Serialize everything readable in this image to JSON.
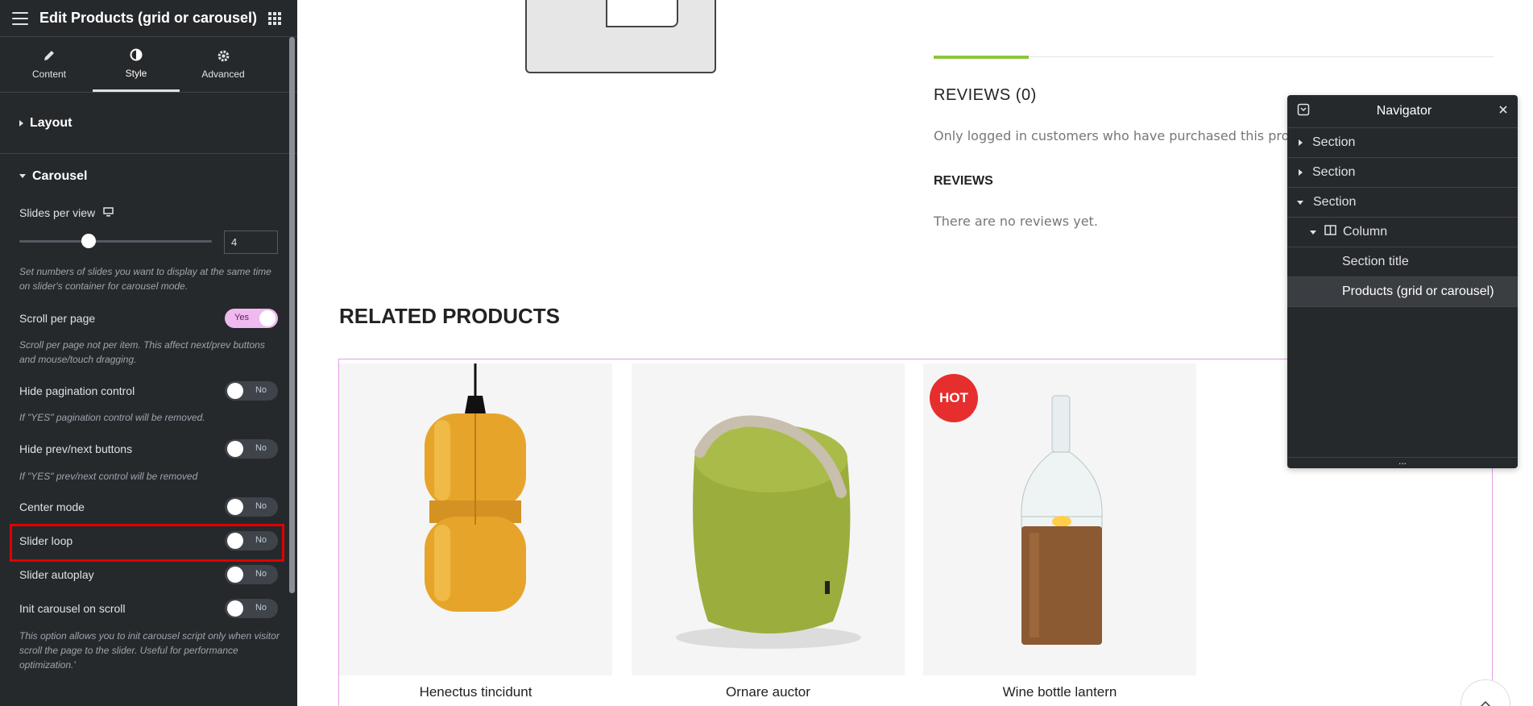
{
  "panel": {
    "title": "Edit Products (grid or carousel)",
    "tabs": [
      {
        "label": "Content",
        "icon": "pencil-icon"
      },
      {
        "label": "Style",
        "icon": "contrast-icon"
      },
      {
        "label": "Advanced",
        "icon": "gear-icon"
      }
    ],
    "active_tab": "Style",
    "sections": {
      "layout": "Layout",
      "carousel": "Carousel"
    },
    "controls": {
      "slides_per_view": {
        "label": "Slides per view",
        "value": "4",
        "slider_fraction": 0.36
      },
      "slides_desc": "Set numbers of slides you want to display at the same time on slider's container for carousel mode.",
      "scroll_per_page": {
        "label": "Scroll per page",
        "state": "Yes"
      },
      "scroll_desc": "Scroll per page not per item. This affect next/prev buttons and mouse/touch dragging.",
      "hide_pagination": {
        "label": "Hide pagination control",
        "state": "No"
      },
      "hide_pagination_desc": "If \"YES\" pagination control will be removed.",
      "hide_prevnext": {
        "label": "Hide prev/next buttons",
        "state": "No"
      },
      "hide_prevnext_desc": "If \"YES\" prev/next control will be removed",
      "center_mode": {
        "label": "Center mode",
        "state": "No"
      },
      "slider_loop": {
        "label": "Slider loop",
        "state": "No"
      },
      "slider_autoplay": {
        "label": "Slider autoplay",
        "state": "No"
      },
      "init_on_scroll": {
        "label": "Init carousel on scroll",
        "state": "No"
      },
      "init_desc": "This option allows you to init carousel script only when visitor scroll the page to the slider. Useful for performance optimization.'"
    }
  },
  "page": {
    "reviews_heading": "REVIEWS (0)",
    "reviews_notice": "Only logged in customers who have purchased this product m",
    "reviews_sub": "REVIEWS",
    "no_reviews": "There are no reviews yet.",
    "related_heading": "RELATED PRODUCTS",
    "products": [
      {
        "name": "Henectus tincidunt"
      },
      {
        "name": "Ornare auctor"
      },
      {
        "name": "Wine bottle lantern",
        "badge": "HOT"
      }
    ]
  },
  "navigator": {
    "title": "Navigator",
    "items": [
      {
        "label": "Section"
      },
      {
        "label": "Section"
      },
      {
        "label": "Section"
      },
      {
        "label": "Column"
      },
      {
        "label": "Section title"
      },
      {
        "label": "Products (grid or carousel)"
      }
    ],
    "footer": "..."
  },
  "colors": {
    "panel_bg": "#26292c",
    "accent_green": "#8dc63f",
    "widget_outline": "#e79be7",
    "hot_badge": "#e62e2e",
    "highlight_box": "#e00000"
  }
}
